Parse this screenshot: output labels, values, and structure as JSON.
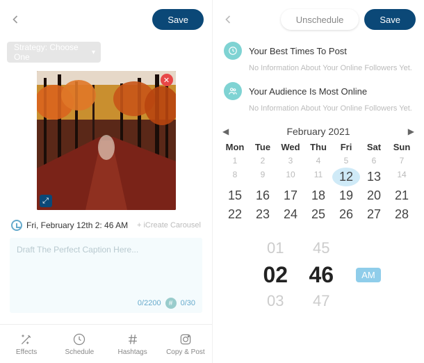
{
  "left": {
    "save": "Save",
    "strategy_label": "Strategy: Choose One",
    "schedule_time": "Fri, February 12th 2: 46 AM",
    "carousel": "+ iCreate Carousel",
    "caption_placeholder": "Draft The Perfect Caption Here...",
    "char_counter": "0/2200",
    "hash_counter": "0/30",
    "tools": {
      "effects": "Effects",
      "schedule": "Schedule",
      "hashtags": "Hashtags",
      "copy": "Copy & Post"
    }
  },
  "right": {
    "unschedule": "Unschedule",
    "save": "Save",
    "best_times": "Your Best Times To Post",
    "best_times_sub": "No Information About Your Online Followers Yet.",
    "audience": "Your Audience Is Most Online",
    "audience_sub": "No Information About Your Online Followers Yet.",
    "cal": {
      "month": "February 2021",
      "dow": [
        "Mon",
        "Tue",
        "Wed",
        "Thu",
        "Fri",
        "Sat",
        "Sun"
      ],
      "rows": [
        [
          "1",
          "2",
          "3",
          "4",
          "5",
          "6",
          "7"
        ],
        [
          "8",
          "9",
          "10",
          "11",
          "12",
          "13",
          "14"
        ],
        [
          "15",
          "16",
          "17",
          "18",
          "19",
          "20",
          "21"
        ],
        [
          "22",
          "23",
          "24",
          "25",
          "26",
          "27",
          "28"
        ]
      ],
      "selected": "12"
    },
    "time": {
      "h_prev": "01",
      "h_cur": "02",
      "h_next": "03",
      "m_prev": "45",
      "m_cur": "46",
      "m_next": "47",
      "ampm": "AM"
    }
  }
}
